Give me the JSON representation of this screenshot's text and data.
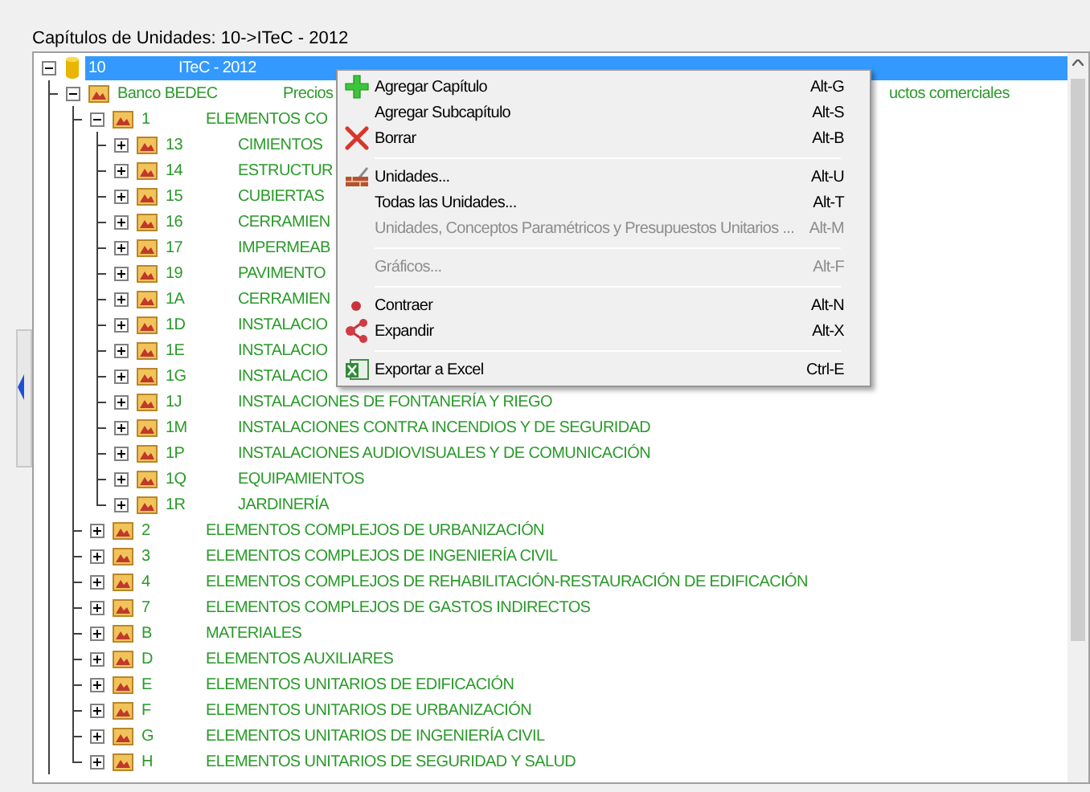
{
  "window": {
    "title": "Capítulos de Unidades: 10->ITeC - 2012"
  },
  "tree": [
    {
      "kind": "root",
      "code": "10",
      "description": "ITeC - 2012",
      "selected": true,
      "expanded": true,
      "children": [
        {
          "kind": "chapter",
          "code": "Banco BEDEC",
          "description": "Precios",
          "description_tail": "uctos comerciales",
          "selected": false,
          "expanded": true,
          "children": [
            {
              "kind": "chapter",
              "code": "1",
              "description": "ELEMENTOS CO",
              "selected": false,
              "expanded": true,
              "children": [
                {
                  "kind": "chapter",
                  "code": "13",
                  "description": "CIMIENTOS",
                  "selected": false,
                  "expanded": false
                },
                {
                  "kind": "chapter",
                  "code": "14",
                  "description": "ESTRUCTUR",
                  "selected": false,
                  "expanded": false
                },
                {
                  "kind": "chapter",
                  "code": "15",
                  "description": "CUBIERTAS",
                  "selected": false,
                  "expanded": false
                },
                {
                  "kind": "chapter",
                  "code": "16",
                  "description": "CERRAMIEN",
                  "selected": false,
                  "expanded": false
                },
                {
                  "kind": "chapter",
                  "code": "17",
                  "description": "IMPERMEAB",
                  "selected": false,
                  "expanded": false
                },
                {
                  "kind": "chapter",
                  "code": "19",
                  "description": "PAVIMENTO",
                  "selected": false,
                  "expanded": false
                },
                {
                  "kind": "chapter",
                  "code": "1A",
                  "description": "CERRAMIEN",
                  "selected": false,
                  "expanded": false
                },
                {
                  "kind": "chapter",
                  "code": "1D",
                  "description": "INSTALACIO",
                  "selected": false,
                  "expanded": false
                },
                {
                  "kind": "chapter",
                  "code": "1E",
                  "description": "INSTALACIO",
                  "selected": false,
                  "expanded": false
                },
                {
                  "kind": "chapter",
                  "code": "1G",
                  "description": "INSTALACIO",
                  "selected": false,
                  "expanded": false
                },
                {
                  "kind": "chapter",
                  "code": "1J",
                  "description": "INSTALACIONES DE FONTANERÍA Y RIEGO",
                  "selected": false,
                  "expanded": false
                },
                {
                  "kind": "chapter",
                  "code": "1M",
                  "description": "INSTALACIONES CONTRA INCENDIOS Y DE SEGURIDAD",
                  "selected": false,
                  "expanded": false
                },
                {
                  "kind": "chapter",
                  "code": "1P",
                  "description": "INSTALACIONES AUDIOVISUALES Y DE COMUNICACIÓN",
                  "selected": false,
                  "expanded": false
                },
                {
                  "kind": "chapter",
                  "code": "1Q",
                  "description": "EQUIPAMIENTOS",
                  "selected": false,
                  "expanded": false
                },
                {
                  "kind": "chapter",
                  "code": "1R",
                  "description": "JARDINERÍA",
                  "selected": false,
                  "expanded": false
                }
              ]
            },
            {
              "kind": "chapter",
              "code": "2",
              "description": "ELEMENTOS COMPLEJOS DE URBANIZACIÓN",
              "selected": false,
              "expanded": false
            },
            {
              "kind": "chapter",
              "code": "3",
              "description": "ELEMENTOS COMPLEJOS DE INGENIERÍA CIVIL",
              "selected": false,
              "expanded": false
            },
            {
              "kind": "chapter",
              "code": "4",
              "description": "ELEMENTOS COMPLEJOS DE REHABILITACIÓN-RESTAURACIÓN DE EDIFICACIÓN",
              "selected": false,
              "expanded": false
            },
            {
              "kind": "chapter",
              "code": "7",
              "description": "ELEMENTOS COMPLEJOS DE GASTOS INDIRECTOS",
              "selected": false,
              "expanded": false
            },
            {
              "kind": "chapter",
              "code": "B",
              "description": "MATERIALES",
              "selected": false,
              "expanded": false
            },
            {
              "kind": "chapter",
              "code": "D",
              "description": "ELEMENTOS AUXILIARES",
              "selected": false,
              "expanded": false
            },
            {
              "kind": "chapter",
              "code": "E",
              "description": "ELEMENTOS UNITARIOS DE EDIFICACIÓN",
              "selected": false,
              "expanded": false
            },
            {
              "kind": "chapter",
              "code": "F",
              "description": "ELEMENTOS UNITARIOS DE URBANIZACIÓN",
              "selected": false,
              "expanded": false
            },
            {
              "kind": "chapter",
              "code": "G",
              "description": "ELEMENTOS UNITARIOS DE INGENIERÍA CIVIL",
              "selected": false,
              "expanded": false
            },
            {
              "kind": "chapter",
              "code": "H",
              "description": "ELEMENTOS UNITARIOS DE SEGURIDAD Y SALUD",
              "selected": false,
              "expanded": false
            }
          ]
        }
      ]
    }
  ],
  "context_menu": {
    "items": [
      {
        "kind": "item",
        "label": "Agregar Capítulo",
        "shortcut": "Alt-G",
        "disabled": false
      },
      {
        "kind": "item",
        "label": "Agregar Subcapítulo",
        "shortcut": "Alt-S",
        "disabled": false
      },
      {
        "kind": "item",
        "label": "Borrar",
        "shortcut": "Alt-B",
        "disabled": false
      },
      {
        "kind": "separator"
      },
      {
        "kind": "item",
        "label": "Unidades...",
        "shortcut": "Alt-U",
        "disabled": false
      },
      {
        "kind": "item",
        "label": "Todas las Unidades...",
        "shortcut": "Alt-T",
        "disabled": false
      },
      {
        "kind": "item",
        "label": "Unidades, Conceptos Paramétricos y Presupuestos Unitarios ...",
        "shortcut": "Alt-M",
        "disabled": true
      },
      {
        "kind": "separator"
      },
      {
        "kind": "item",
        "label": "Gráficos...",
        "shortcut": "Alt-F",
        "disabled": true
      },
      {
        "kind": "separator"
      },
      {
        "kind": "item",
        "label": "Contraer",
        "shortcut": "Alt-N",
        "disabled": false
      },
      {
        "kind": "item",
        "label": "Expandir",
        "shortcut": "Alt-X",
        "disabled": false
      },
      {
        "kind": "separator"
      },
      {
        "kind": "item",
        "label": "Exportar a Excel",
        "shortcut": "Ctrl-E",
        "disabled": false
      }
    ]
  }
}
